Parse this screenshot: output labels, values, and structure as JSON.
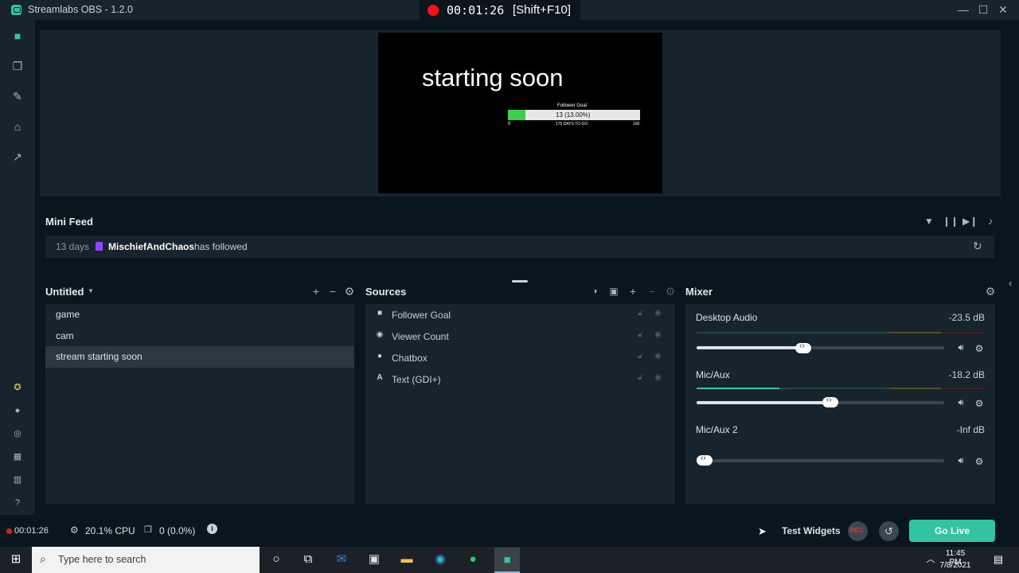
{
  "app": {
    "title": "Streamlabs OBS - 1.2.0"
  },
  "recording": {
    "time": "00:01:26",
    "hotkey": "[Shift+F10]"
  },
  "preview": {
    "main_text": "starting soon",
    "goal_title": "Follower Goal",
    "goal_value": "13 (13.00%)",
    "goal_min": "0",
    "goal_days": "175 DAYS TO GO",
    "goal_max": "100",
    "goal_progress": 0.13
  },
  "minifeed": {
    "title": "Mini Feed",
    "entries": [
      {
        "age": "13 days",
        "user": "MischiefAndChaos",
        "action": "has followed"
      }
    ]
  },
  "scenes": {
    "title": "Untitled",
    "items": [
      "game",
      "cam",
      "stream starting soon"
    ],
    "selected": "stream starting soon"
  },
  "sources": {
    "title": "Sources",
    "items": [
      {
        "label": "Follower Goal",
        "icon": "widget-icon"
      },
      {
        "label": "Viewer Count",
        "icon": "eye-icon"
      },
      {
        "label": "Chatbox",
        "icon": "chat-icon"
      },
      {
        "label": "Text (GDI+)",
        "icon": "text-icon"
      }
    ]
  },
  "mixer": {
    "title": "Mixer",
    "channels": [
      {
        "name": "Desktop Audio",
        "db": "-23.5 dB",
        "level": 0.43
      },
      {
        "name": "Mic/Aux",
        "db": "-18.2 dB",
        "level": 0.54
      },
      {
        "name": "Mic/Aux 2",
        "db": "-Inf dB",
        "level": 0.0
      }
    ]
  },
  "footer": {
    "rec_time": "00:01:26",
    "cpu": "20.1% CPU",
    "dropped": "0 (0.0%)",
    "test_widgets": "Test Widgets",
    "rec_label": "REC",
    "go_live": "Go Live"
  },
  "taskbar": {
    "search_placeholder": "Type here to search",
    "time": "11:45 PM",
    "date": "7/8/2021"
  },
  "colors": {
    "accent": "#31c3a2",
    "record": "#ff0e1a",
    "panel": "#17242d",
    "background": "#09161d"
  }
}
